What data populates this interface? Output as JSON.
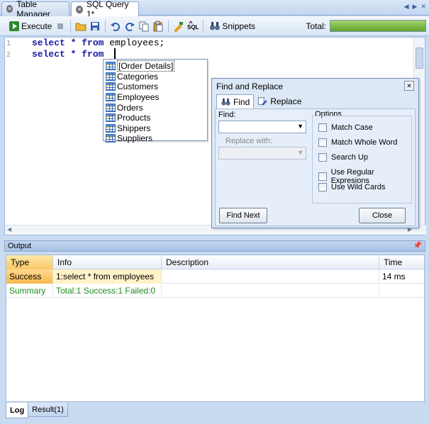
{
  "tabs": [
    {
      "label": "Table Manager"
    },
    {
      "label": "SQL Query 1*"
    }
  ],
  "toolbar": {
    "execute_label": "Execute",
    "snippets_label": "Snippets",
    "total_label": "Total:",
    "total_progress": 1.0
  },
  "editor": {
    "lines": [
      {
        "num": "1",
        "text": "employees;"
      },
      {
        "num": "2",
        "text": ""
      }
    ],
    "kw_select": "select",
    "kw_star": "*",
    "kw_from": "from"
  },
  "autocomplete": {
    "items": [
      "[Order Details]",
      "Categories",
      "Customers",
      "Employees",
      "Orders",
      "Products",
      "Shippers",
      "Suppliers"
    ]
  },
  "find_replace": {
    "title": "Find and Replace",
    "tab_find": "Find",
    "tab_replace": "Replace",
    "find_label": "Find:",
    "replace_label": "Replace with:",
    "options_label": "Options",
    "options": [
      "Match Case",
      "Match Whole Word",
      "Search Up",
      "Use Regular Expresions",
      "Use Wild Cards"
    ],
    "find_next_label": "Find Next",
    "close_label": "Close"
  },
  "output": {
    "title": "Output",
    "columns": [
      "Type",
      "Info",
      "Description",
      "Time"
    ],
    "rows": [
      {
        "type": "Success",
        "info": "1:select * from employees",
        "description": "",
        "time": "14 ms"
      },
      {
        "type": "Summary",
        "info": "Total:1 Success:1 Failed:0",
        "description": "",
        "time": ""
      }
    ]
  },
  "bottom_tabs": [
    {
      "label": "Log"
    },
    {
      "label": "Result(1)"
    }
  ],
  "colors": {
    "keyword": "#1a1aa6",
    "summary_text": "#1f8b1f",
    "success_bg": "#f6b94d",
    "progress": "#5ea32c"
  }
}
